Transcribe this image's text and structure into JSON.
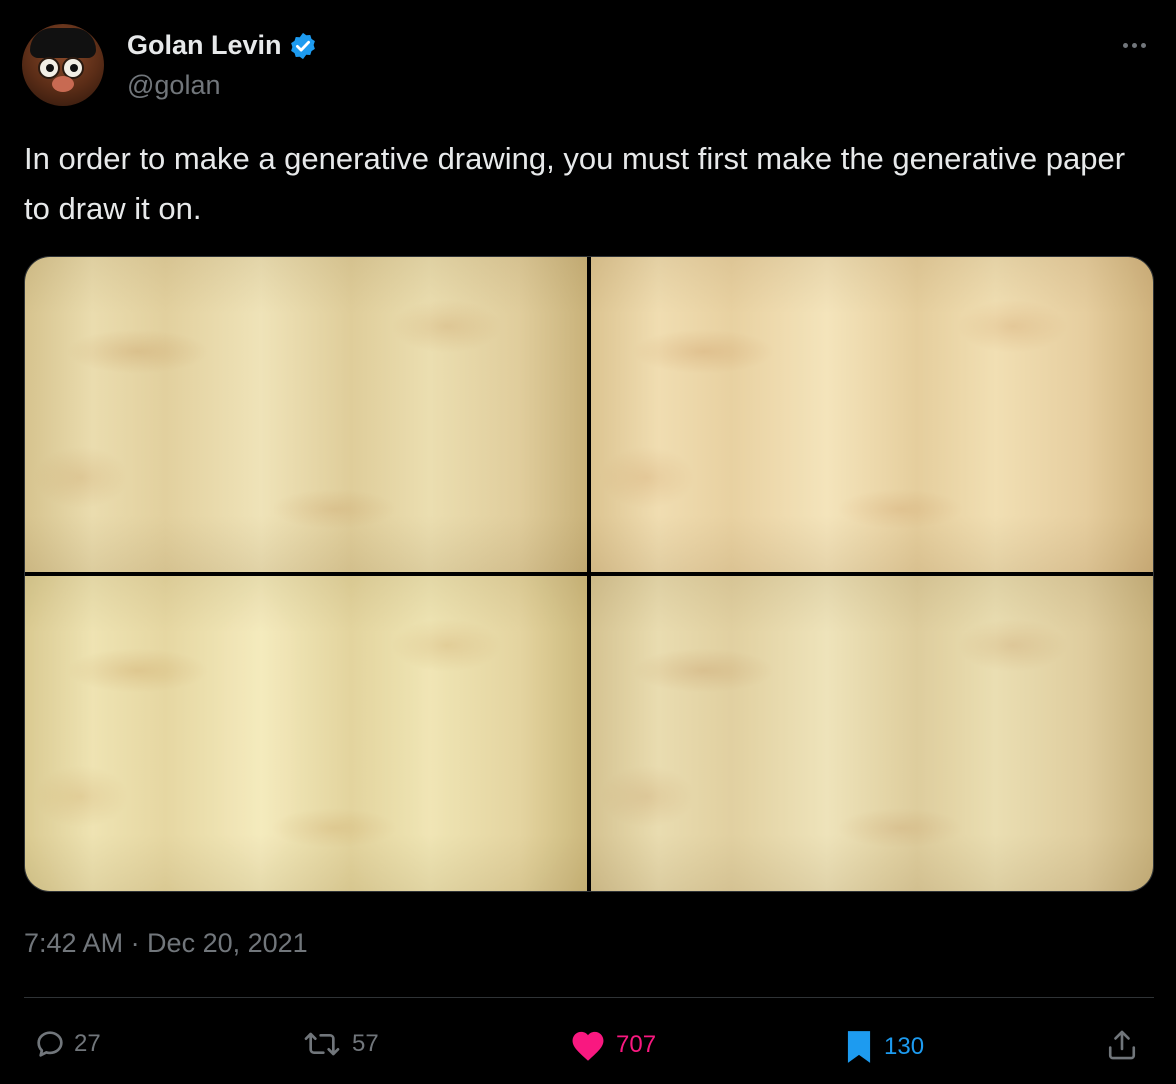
{
  "author": {
    "name": "Golan Levin",
    "handle": "@golan",
    "avatar_icon": "avatar-image",
    "verified_icon": "verified-badge-icon",
    "verified_color": "#1d9bf0"
  },
  "tweet": {
    "text": "In order to make a generative drawing, you must first make the generative paper to draw it on.",
    "timestamp": "7:42 AM · Dec 20, 2021"
  },
  "media": {
    "image_count": 4
  },
  "actions": {
    "reply_count": "27",
    "retweet_count": "57",
    "like_count": "707",
    "bookmark_count": "130",
    "like_color": "#f91880",
    "bookmark_color": "#1d9bf0"
  }
}
